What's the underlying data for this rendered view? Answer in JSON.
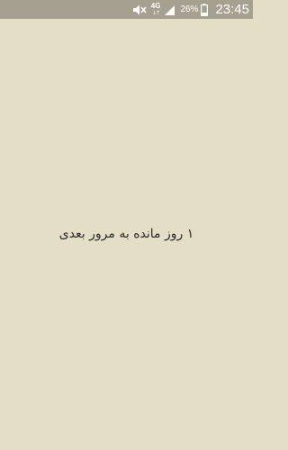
{
  "status_bar": {
    "network": "4G",
    "battery_percent": "26%",
    "time": "23:45",
    "icons": [
      "mute-icon",
      "signal-icon",
      "battery-icon"
    ]
  },
  "main": {
    "message": "۱ روز مانده به مرور بعدی"
  }
}
